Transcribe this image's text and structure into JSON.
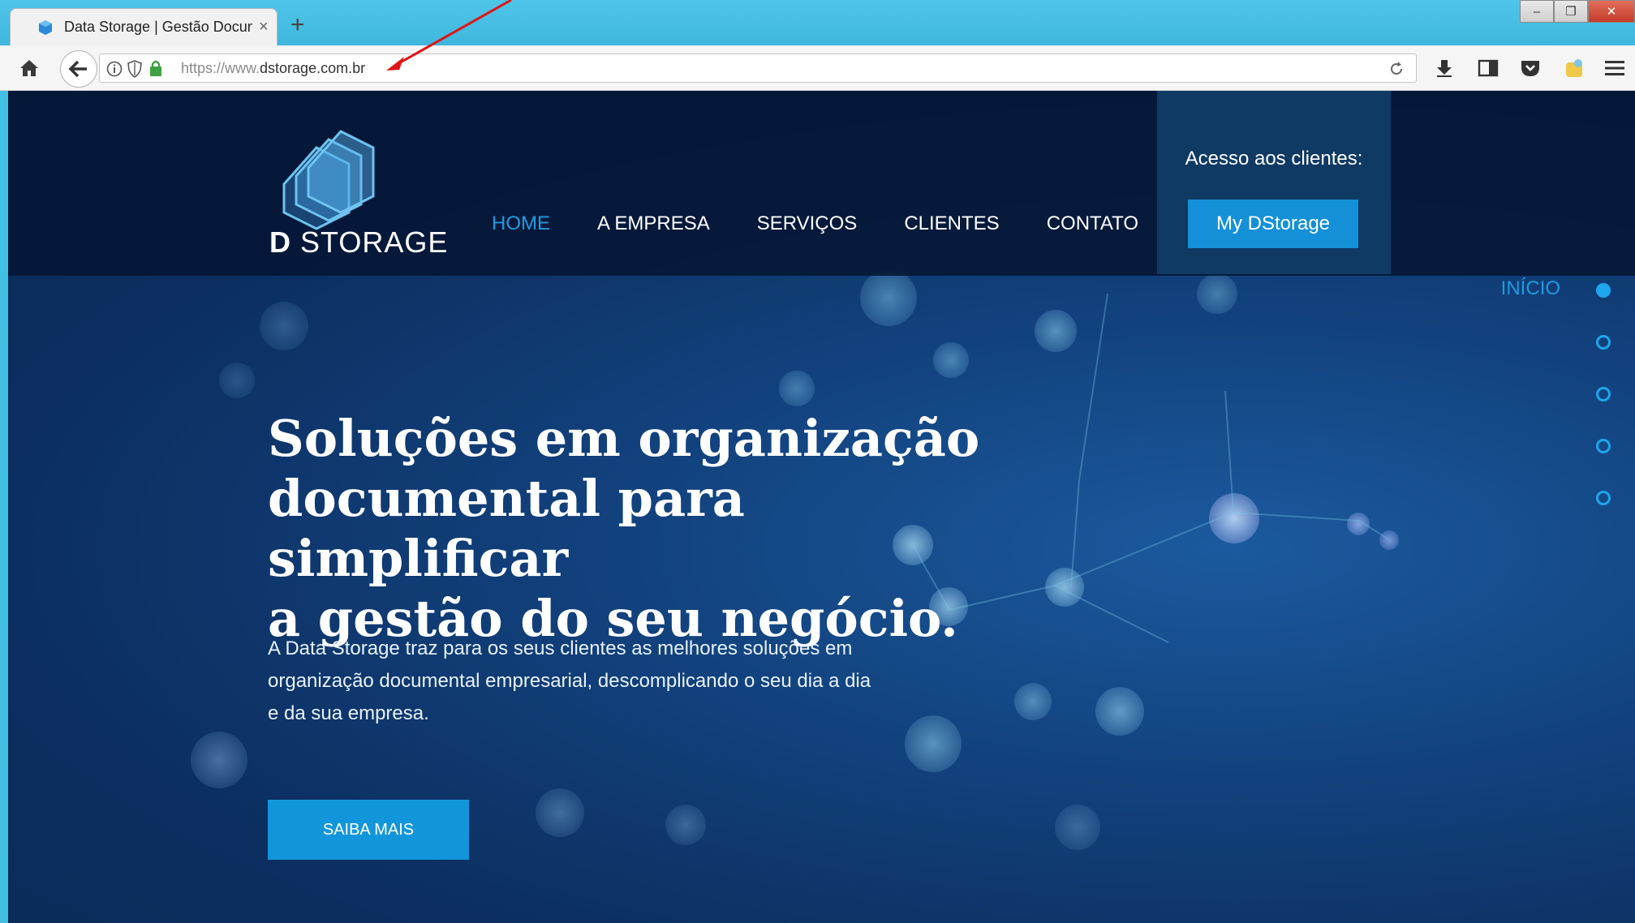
{
  "browser": {
    "tab_title": "Data Storage | Gestão Docum",
    "tab_close": "×",
    "new_tab": "+",
    "url_scheme": "https://www.",
    "url_host": "dstorage.com.br",
    "window_buttons": [
      "–",
      "❐",
      "✕"
    ]
  },
  "site": {
    "logo_bold": "D",
    "logo_rest": " STORAGE",
    "menu": [
      "HOME",
      "A EMPRESA",
      "SERVIÇOS",
      "CLIENTES",
      "CONTATO"
    ],
    "active_menu": "HOME",
    "client_access_label": "Acesso aos clientes:",
    "client_button": "My DStorage"
  },
  "side_nav": {
    "label": "INÍCIO",
    "dot_count": 5,
    "active_index": 0
  },
  "hero": {
    "title_lines": [
      "Soluções em organização",
      "documental para simplificar",
      "a gestão do seu negócio."
    ],
    "description": "A Data Storage traz para os seus clientes as melhores soluções em organização documental empresarial, descomplicando o seu dia a dia e da sua empresa.",
    "cta": "SAIBA MAIS"
  },
  "colors": {
    "accent": "#1e9be0",
    "button": "#1296db",
    "header_bg": "#06163a",
    "client_box": "#0f3a63",
    "annotation_arrow": "#e01414"
  }
}
